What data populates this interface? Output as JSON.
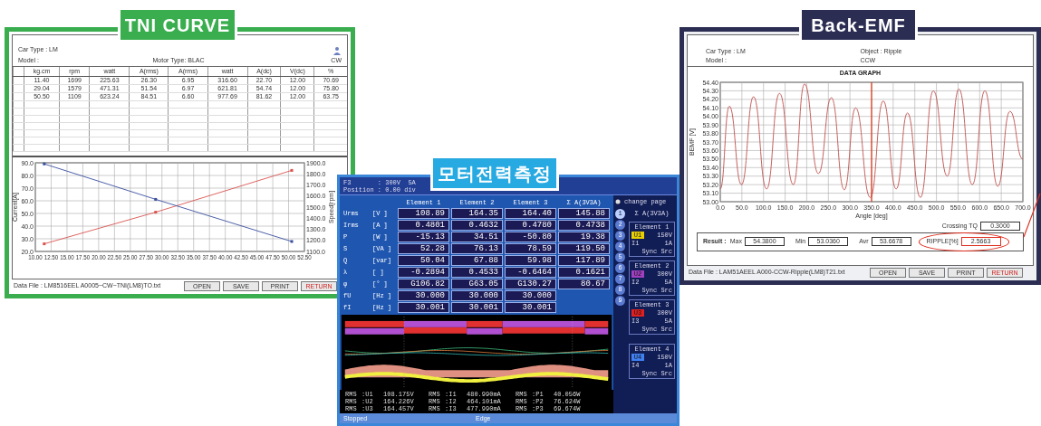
{
  "tni_curve": {
    "label": "TNI CURVE",
    "info": {
      "car_type": "Car Type : LM",
      "model": "Model :",
      "motor_type": "Motor Type: BLAC",
      "direction": "CW"
    },
    "table": {
      "units": [
        "kg.cm",
        "rpm",
        "watt",
        "A(rms)",
        "A(rms)",
        "watt",
        "A(dc)",
        "V(dc)",
        "%"
      ],
      "rows": [
        [
          "11.40",
          "1699",
          "225.63",
          "26.30",
          "6.95",
          "316.60",
          "22.70",
          "12.00",
          "70.69"
        ],
        [
          "29.04",
          "1579",
          "471.31",
          "51.54",
          "6.97",
          "621.81",
          "54.74",
          "12.00",
          "75.80"
        ],
        [
          "50.50",
          "1109",
          "623.24",
          "84.51",
          "6.60",
          "977.69",
          "81.62",
          "12.00",
          "63.75"
        ]
      ]
    },
    "chart_data": {
      "type": "line",
      "ylabel": "Current[A]",
      "y2label": "Speed[rpm]",
      "grid": true,
      "x": [
        11.4,
        29.0,
        50.5
      ],
      "series": [
        {
          "color": "#d9534f",
          "marker": "square",
          "values": [
            26,
            51,
            84
          ]
        },
        {
          "color": "#3a4fa0",
          "axis": "y2",
          "marker": "square",
          "values": [
            1890,
            1570,
            1190
          ]
        }
      ],
      "xlim": [
        10,
        52.5
      ],
      "ylim": [
        20,
        90
      ],
      "y2lim": [
        1100,
        1900
      ],
      "xticks": [
        {
          "value": 10,
          "label": "10.00"
        },
        {
          "value": 12.5,
          "label": "12.50"
        },
        {
          "value": 15,
          "label": "15.00"
        },
        {
          "value": 17.5,
          "label": "17.50"
        },
        {
          "value": 20,
          "label": "20.00"
        },
        {
          "value": 22.5,
          "label": "22.50"
        },
        {
          "value": 25,
          "label": "25.00"
        },
        {
          "value": 27.5,
          "label": "27.50"
        },
        {
          "value": 30,
          "label": "30.00"
        },
        {
          "value": 32.5,
          "label": "32.50"
        },
        {
          "value": 35,
          "label": "35.00"
        },
        {
          "value": 37.5,
          "label": "37.50"
        },
        {
          "value": 40,
          "label": "40.00"
        },
        {
          "value": 42.5,
          "label": "42.50"
        },
        {
          "value": 45,
          "label": "45.00"
        },
        {
          "value": 47.5,
          "label": "47.50"
        },
        {
          "value": 50,
          "label": "50.00"
        },
        {
          "value": 52.5,
          "label": "52.50"
        }
      ],
      "yticks": [
        {
          "value": 20,
          "label": "20.0"
        },
        {
          "value": 30,
          "label": "30.0"
        },
        {
          "value": 40,
          "label": "40.0"
        },
        {
          "value": 50,
          "label": "50.0"
        },
        {
          "value": 60,
          "label": "60.0"
        },
        {
          "value": 70,
          "label": "70.0"
        },
        {
          "value": 80,
          "label": "80.0"
        },
        {
          "value": 90,
          "label": "90.0"
        }
      ],
      "y2ticks": [
        {
          "value": 1100,
          "label": "1100.0"
        },
        {
          "value": 1200,
          "label": "1200.0"
        },
        {
          "value": 1300,
          "label": "1300.0"
        },
        {
          "value": 1400,
          "label": "1400.0"
        },
        {
          "value": 1500,
          "label": "1500.0"
        },
        {
          "value": 1600,
          "label": "1600.0"
        },
        {
          "value": 1700,
          "label": "1700.0"
        },
        {
          "value": 1800,
          "label": "1800.0"
        },
        {
          "value": 1900,
          "label": "1900.0"
        }
      ]
    },
    "data_file": "Data File : LM8516EEL A0005~CW~TNI(LM8)TO.txt",
    "buttons": [
      {
        "label": "OPEN",
        "kind": "normal"
      },
      {
        "label": "SAVE",
        "kind": "normal"
      },
      {
        "label": "PRINT",
        "kind": "normal"
      },
      {
        "label": "RETURN",
        "kind": "exit"
      }
    ]
  },
  "power_measurement": {
    "label": "모터전력측정",
    "top_status": [
      "F3       : 300V  5A",
      "Position : 0.00 div"
    ],
    "table": {
      "columns": [
        "Element 1",
        "Element 2",
        "Element 3",
        "Σ A(3V3A)"
      ],
      "rows": [
        {
          "name": "Urms",
          "unit": "[V  ]",
          "values": [
            "108.89",
            "164.35",
            "164.40",
            "145.88"
          ]
        },
        {
          "name": "Irms",
          "unit": "[A  ]",
          "values": [
            "0.4801",
            "0.4632",
            "0.4780",
            "0.4738"
          ]
        },
        {
          "name": "P",
          "unit": "[W  ]",
          "values": [
            "-15.13",
            "34.51",
            "-50.80",
            "19.38"
          ]
        },
        {
          "name": "S",
          "unit": "[VA ]",
          "values": [
            "52.28",
            "76.13",
            "78.59",
            "119.50"
          ]
        },
        {
          "name": "Q",
          "unit": "[var]",
          "values": [
            "50.04",
            "67.88",
            "59.98",
            "117.89"
          ]
        },
        {
          "name": "λ",
          "unit": "[   ]",
          "values": [
            "-0.2894",
            "0.4533",
            "-0.6464",
            "0.1621"
          ]
        },
        {
          "name": "φ",
          "unit": "[°  ]",
          "values": [
            "G106.82",
            "G63.05",
            "G130.27",
            "80.67"
          ]
        },
        {
          "name": "fU",
          "unit": "[Hz ]",
          "values": [
            "30.000",
            "30.000",
            "30.000"
          ]
        },
        {
          "name": "fI",
          "unit": "[Hz ]",
          "values": [
            "30.001",
            "30.001",
            "30.001"
          ]
        }
      ]
    },
    "change_page": "change page",
    "pages": [
      {
        "label": "1",
        "selected": true
      },
      {
        "label": "2",
        "selected": false
      },
      {
        "label": "3",
        "selected": false
      },
      {
        "label": "4",
        "selected": false
      },
      {
        "label": "5",
        "selected": false
      },
      {
        "label": "6",
        "selected": false
      },
      {
        "label": "7",
        "selected": false
      },
      {
        "label": "8",
        "selected": false
      },
      {
        "label": "9",
        "selected": false
      }
    ],
    "sum_label": "Σ A(3V3A)",
    "elements": [
      {
        "title": "Element 1",
        "u": "U1",
        "u_range": "150V",
        "i": "I1",
        "i_range": "1A",
        "sync": "Sync Src",
        "color": "#e8d000"
      },
      {
        "title": "Element 2",
        "u": "U2",
        "u_range": "300V",
        "i": "I2",
        "i_range": "5A",
        "sync": "Sync Src",
        "color": "#a040c0"
      },
      {
        "title": "Element 3",
        "u": "U3",
        "u_range": "300V",
        "i": "I3",
        "i_range": "5A",
        "sync": "Sync Src",
        "color": "#e02020"
      },
      {
        "title": "Element 4",
        "u": "U4",
        "u_range": "150V",
        "i": "I4",
        "i_range": "1A",
        "sync": "Sync Src",
        "color": "#4080f0"
      }
    ],
    "readouts": [
      [
        "RMS",
        ":U1",
        "108.175V",
        "RMS",
        ":I1",
        "480.990mA",
        "RMS",
        ":P1",
        "40.056W"
      ],
      [
        "RMS",
        ":U2",
        "164.226V",
        "RMS",
        ":I2",
        "464.101mA",
        "RMS",
        ":P2",
        "76.624W"
      ],
      [
        "RMS",
        ":U3",
        "164.457V",
        "RMS",
        ":I3",
        "477.990mA",
        "RMS",
        ":P3",
        "69.674W"
      ]
    ],
    "status": [
      "Stopped",
      "Edge"
    ]
  },
  "back_emf": {
    "label": "Back-EMF",
    "info": {
      "car_type": "Car Type : LM",
      "model": "Model :",
      "object": "Object : Ripple",
      "direction": "CCW"
    },
    "chart_data": {
      "type": "line",
      "title": "DATA GRAPH",
      "xlabel": "Angle [deg]",
      "ylabel": "BEMF [V]",
      "grid": true,
      "x": [
        0,
        21,
        49,
        77,
        107,
        137,
        169,
        195,
        227,
        257,
        287,
        313,
        347,
        377,
        407,
        433,
        463,
        493,
        525,
        552,
        583,
        612,
        642,
        670,
        700
      ],
      "series": [
        {
          "color": "#c0504d",
          "values": [
            53.15,
            54.12,
            53.2,
            54.23,
            53.15,
            54.27,
            53.2,
            54.38,
            53.33,
            54.22,
            53.14,
            54.1,
            53.05,
            54.18,
            53.15,
            54.04,
            53.05,
            54.3,
            53.3,
            54.32,
            53.2,
            54.3,
            53.18,
            54.06,
            53.5
          ]
        }
      ],
      "xlim": [
        0,
        700
      ],
      "ylim": [
        53,
        54.4
      ],
      "xticks": [
        {
          "value": 0,
          "label": "0.0"
        },
        {
          "value": 50,
          "label": "50.0"
        },
        {
          "value": 100,
          "label": "100.0"
        },
        {
          "value": 150,
          "label": "150.0"
        },
        {
          "value": 200,
          "label": "200.0"
        },
        {
          "value": 250,
          "label": "250.0"
        },
        {
          "value": 300,
          "label": "300.0"
        },
        {
          "value": 350,
          "label": "350.0"
        },
        {
          "value": 400,
          "label": "400.0"
        },
        {
          "value": 450,
          "label": "450.0"
        },
        {
          "value": 500,
          "label": "500.0"
        },
        {
          "value": 550,
          "label": "550.0"
        },
        {
          "value": 600,
          "label": "600.0"
        },
        {
          "value": 650,
          "label": "650.0"
        },
        {
          "value": 700,
          "label": "700.0"
        }
      ],
      "yticks": [
        {
          "value": 53,
          "label": "53.00"
        },
        {
          "value": 53.1,
          "label": "53.10"
        },
        {
          "value": 53.2,
          "label": "53.20"
        },
        {
          "value": 53.3,
          "label": "53.30"
        },
        {
          "value": 53.4,
          "label": "53.40"
        },
        {
          "value": 53.5,
          "label": "53.50"
        },
        {
          "value": 53.6,
          "label": "53.60"
        },
        {
          "value": 53.7,
          "label": "53.70"
        },
        {
          "value": 53.8,
          "label": "53.80"
        },
        {
          "value": 53.9,
          "label": "53.90"
        },
        {
          "value": 54,
          "label": "54.00"
        },
        {
          "value": 54.1,
          "label": "54.10"
        },
        {
          "value": 54.2,
          "label": "54.20"
        },
        {
          "value": 54.3,
          "label": "54.30"
        },
        {
          "value": 54.4,
          "label": "54.40"
        }
      ],
      "ref_lines": [
        {
          "axis": "x",
          "value": 350,
          "color": "#e03010"
        }
      ]
    },
    "crossing": {
      "label": "Crossing TQ",
      "value": "0.3000"
    },
    "result": {
      "label": "Result :",
      "fields": [
        {
          "label": "Max",
          "value": "54.3800",
          "highlighted": false
        },
        {
          "label": "Min",
          "value": "53.0360",
          "highlighted": false
        },
        {
          "label": "Avr",
          "value": "53.6678",
          "highlighted": false
        },
        {
          "label": "RIPPLE[%]",
          "value": "2.5663",
          "highlighted": true
        }
      ]
    },
    "data_file": "Data File : LAM51AEEL A000-CCW-Ripple(LM8)T21.txt",
    "buttons": [
      {
        "label": "OPEN",
        "kind": "normal"
      },
      {
        "label": "SAVE",
        "kind": "normal"
      },
      {
        "label": "PRINT",
        "kind": "normal"
      },
      {
        "label": "RETURN",
        "kind": "exit"
      }
    ]
  }
}
